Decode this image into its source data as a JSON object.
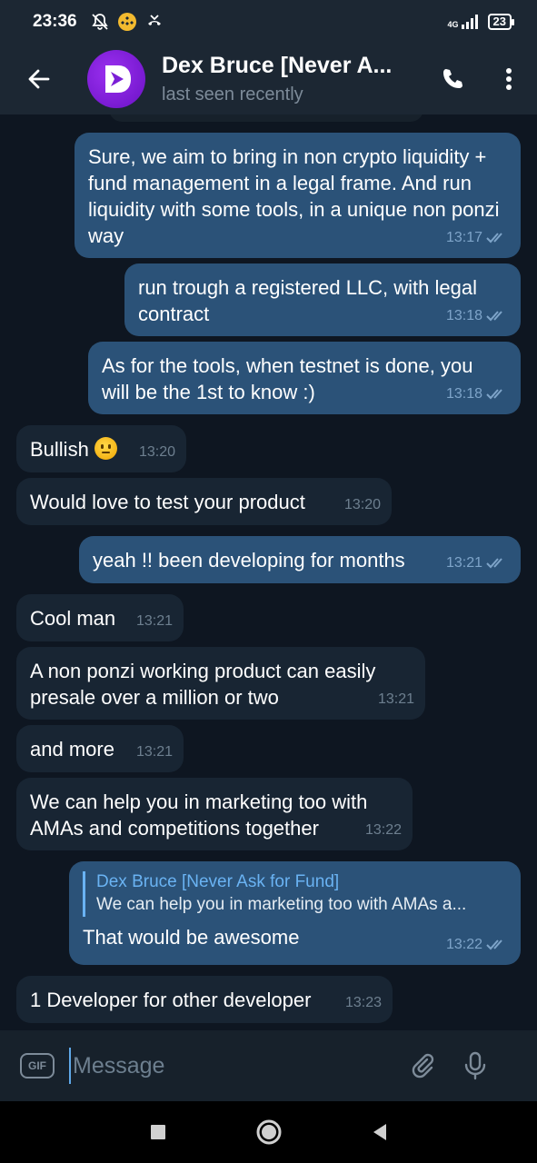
{
  "status_bar": {
    "time": "23:36",
    "network": "4G",
    "battery": "23"
  },
  "header": {
    "title": "Dex Bruce [Never A...",
    "subtitle": "last seen recently",
    "avatar_color": "#8a2be2"
  },
  "messages": [
    {
      "dir": "out",
      "text": "Sure, we aim to bring in non crypto liquidity +  fund management in a legal frame. And run liquidity with some tools, in a unique non ponzi way",
      "time": "13:17",
      "read": true
    },
    {
      "dir": "out",
      "text": "run trough a registered LLC, with legal contract",
      "time": "13:18",
      "read": true
    },
    {
      "dir": "out",
      "text": "As for the tools, when testnet is done, you will be the 1st to know :)",
      "time": "13:18",
      "read": true
    },
    {
      "dir": "in",
      "text": "Bullish",
      "emoji": "slightly-smiling-face",
      "time": "13:20"
    },
    {
      "dir": "in",
      "text": "Would love to test your product",
      "time": "13:20"
    },
    {
      "dir": "out",
      "text": "yeah !! been developing for months",
      "time": "13:21",
      "read": true
    },
    {
      "dir": "in",
      "text": "Cool man",
      "time": "13:21"
    },
    {
      "dir": "in",
      "text": "A non ponzi working product can easily presale over a million or two",
      "time": "13:21"
    },
    {
      "dir": "in",
      "text": "and more",
      "time": "13:21"
    },
    {
      "dir": "in",
      "text": "We can help you in marketing too with AMAs and competitions together",
      "time": "13:22"
    },
    {
      "dir": "out",
      "reply_to": {
        "name": "Dex Bruce [Never Ask for Fund]",
        "text": "We can help you in marketing too with AMAs a..."
      },
      "text": "That would be awesome",
      "time": "13:22",
      "read": true
    },
    {
      "dir": "in",
      "text": "1 Developer for other developer",
      "time": "13:23"
    }
  ],
  "input": {
    "gif_label": "GIF",
    "placeholder": "Message"
  },
  "colors": {
    "background": "#0e1621",
    "header": "#1c2733",
    "outgoing_bubble": "#2b5278",
    "incoming_bubble": "#182533",
    "accent": "#6ab3f3"
  }
}
